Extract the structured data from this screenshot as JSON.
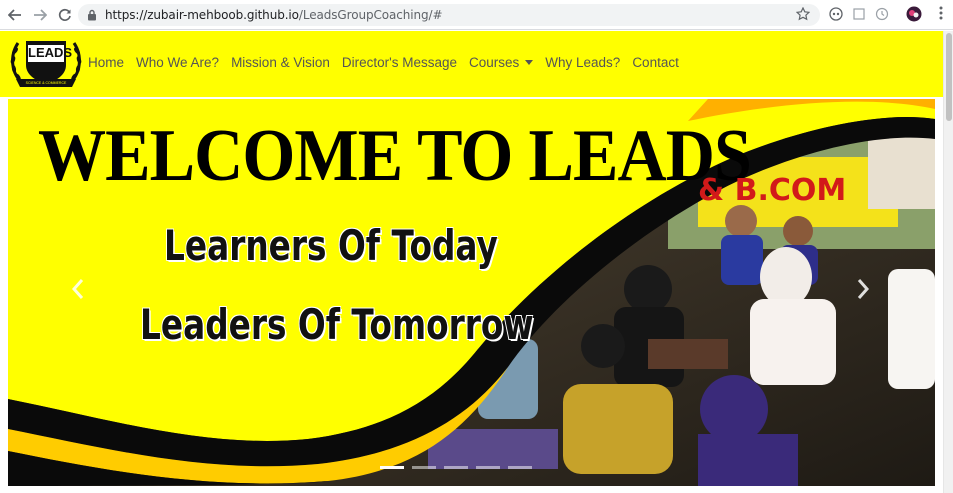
{
  "browser": {
    "url_host": "https://zubair-mehboob.github.io",
    "url_path": "/LeadsGroupCoaching/#"
  },
  "site": {
    "logo_text": "LEADS",
    "logo_sub": "SCIENCE & COMMERCE",
    "nav": {
      "home": "Home",
      "who": "Who We Are?",
      "mission": "Mission & Vision",
      "director": "Director's Message",
      "courses": "Courses",
      "why": "Why Leads?",
      "contact": "Contact"
    }
  },
  "carousel": {
    "headline": "WELCOME TO LEADS",
    "line1": "Learners Of Today",
    "line2": "Leaders Of Tomorrow",
    "banner_text": "& B.COM",
    "prev_icon": "chevron-left-icon",
    "next_icon": "chevron-right-icon",
    "slide_count": 5,
    "active_slide": 1
  },
  "colors": {
    "brand_yellow": "#ffff00",
    "nav_text": "#555555"
  }
}
